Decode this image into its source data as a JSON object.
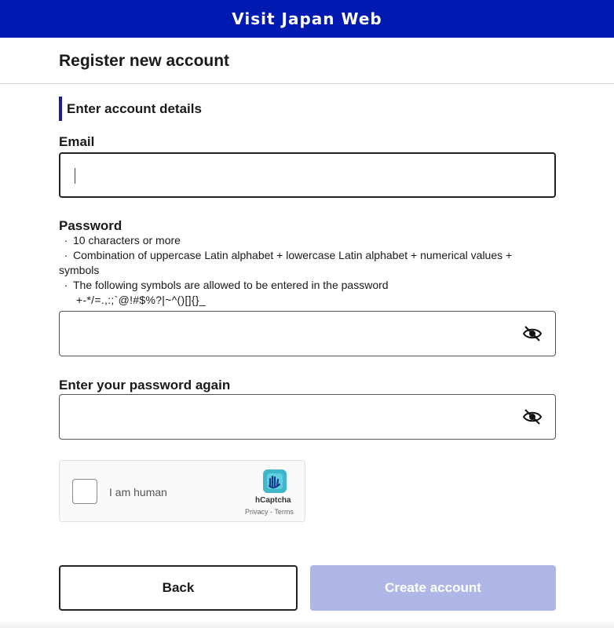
{
  "app": {
    "title": "Visit Japan Web"
  },
  "page": {
    "title": "Register new account"
  },
  "section": {
    "heading": "Enter account details"
  },
  "email": {
    "label": "Email",
    "value": ""
  },
  "password": {
    "label": "Password",
    "hints": [
      "10 characters or more",
      "Combination of uppercase Latin alphabet + lowercase Latin alphabet + numerical values + symbols",
      "The following symbols are allowed to be entered in the password"
    ],
    "allowed_symbols": "+-*/=.,:;`@!#$%?|~^()[]{}_",
    "value": ""
  },
  "password_confirm": {
    "label": "Enter your password again",
    "value": ""
  },
  "captcha": {
    "label": "I am human",
    "brand": "hCaptcha",
    "privacy": "Privacy",
    "separator": " - ",
    "terms": "Terms",
    "checked": false
  },
  "buttons": {
    "back": "Back",
    "create": "Create account"
  },
  "colors": {
    "brand": "#0019b0",
    "accent_bar": "#1d1aa0",
    "disabled_button": "#b0b6e6"
  },
  "icons": {
    "password_toggle": "eye-slash-icon",
    "captcha_logo": "hcaptcha-logo-icon"
  }
}
